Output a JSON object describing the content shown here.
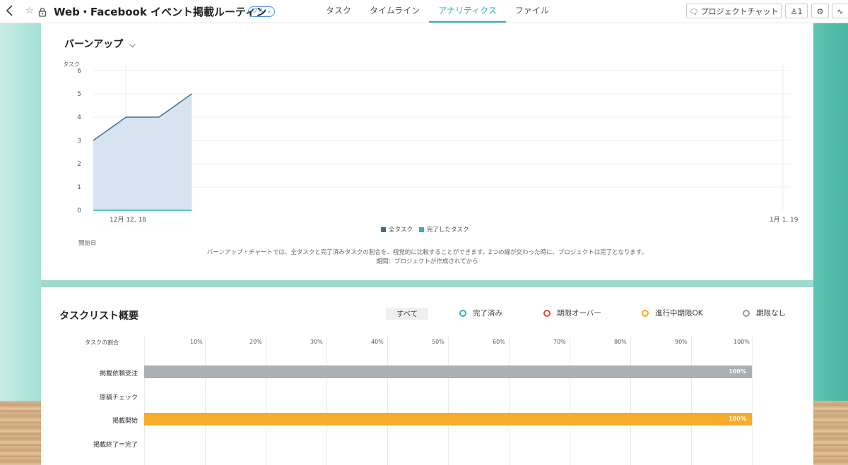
{
  "header": {
    "back_icon": "chevron-left-icon",
    "title": "Web・Facebook イベント掲載ルーティン",
    "badge": "フル",
    "tabs": [
      {
        "label": "タスク",
        "active": false
      },
      {
        "label": "タイムライン",
        "active": false
      },
      {
        "label": "アナリティクス",
        "active": true
      },
      {
        "label": "ファイル",
        "active": false
      }
    ],
    "project_chat": "プロジェクトチャット",
    "members_count": "1"
  },
  "burnup": {
    "title": "バーンアップ",
    "y_axis_label": "タスク",
    "x_axis_caption": "開始日",
    "note_line1": "バーンアップ・チャートでは、全タスクと完了済みタスクの割合を、視覚的に比較することができます。2つの線が交わった時に、プロジェクトは完了となります。",
    "note_line2": "期間：プロジェクトが作成されてから",
    "colors": {
      "all": "#3d6f9a",
      "done": "#2bb4b8",
      "fill": "#d7e3ee"
    }
  },
  "chart_data": {
    "type": "area",
    "ylabel": "タスク",
    "xlabel": "開始日",
    "ylim": [
      0,
      6
    ],
    "yticks": [
      "0",
      "1",
      "2",
      "3",
      "4",
      "5",
      "6"
    ],
    "xticks": [
      "12月 12, 18",
      "1月 1, 19"
    ],
    "series": [
      {
        "name": "全タスク",
        "x": [
          0,
          1,
          2,
          3
        ],
        "values": [
          3,
          4,
          4,
          5
        ]
      },
      {
        "name": "完了したタスク",
        "x": [
          0,
          1,
          2,
          3
        ],
        "values": [
          0,
          0,
          0,
          0
        ]
      }
    ],
    "x_total_span": 21,
    "grid": true,
    "legend": "bottom"
  },
  "tasklist": {
    "title": "タスクリスト概要",
    "filters": [
      {
        "label": "すべて",
        "color": "",
        "selected": true
      },
      {
        "label": "完了済み",
        "color": "#2bb4b8",
        "selected": false
      },
      {
        "label": "期限オーバー",
        "color": "#e0493f",
        "selected": false
      },
      {
        "label": "進行中期限OK",
        "color": "#f5a623",
        "selected": false
      },
      {
        "label": "期限なし",
        "color": "#9b9b9b",
        "selected": false
      }
    ],
    "axis_label": "タスクの割合",
    "percent_ticks": [
      "10%",
      "20%",
      "30%",
      "40%",
      "50%",
      "60%",
      "70%",
      "80%",
      "90%",
      "100%"
    ],
    "rows": [
      {
        "label": "掲載依頼受注",
        "value": 100,
        "value_label": "100%",
        "color": "#a9afb5"
      },
      {
        "label": "原稿チェック",
        "value": 0,
        "value_label": "",
        "color": ""
      },
      {
        "label": "掲載開始",
        "value": 100,
        "value_label": "100%",
        "color": "#f7ac2a"
      },
      {
        "label": "掲載終了＝完了",
        "value": 0,
        "value_label": "",
        "color": ""
      }
    ]
  }
}
